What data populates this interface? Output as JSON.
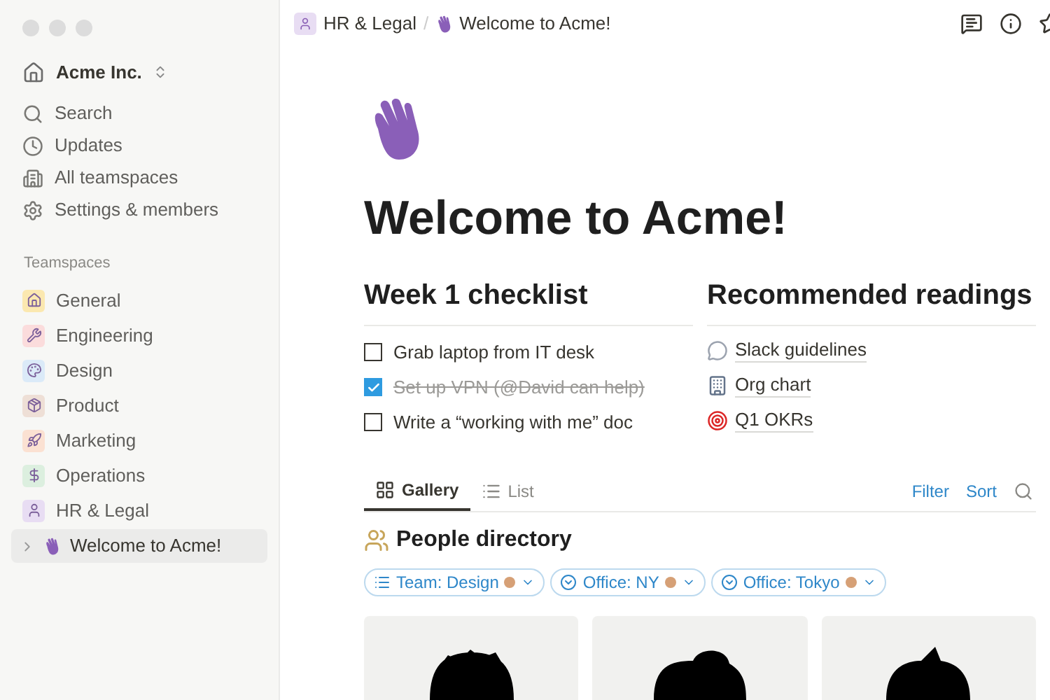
{
  "workspace": {
    "name": "Acme Inc."
  },
  "nav": [
    {
      "label": "Search",
      "kind": "search"
    },
    {
      "label": "Updates",
      "kind": "clock"
    },
    {
      "label": "All teamspaces",
      "kind": "building"
    },
    {
      "label": "Settings & members",
      "kind": "gear"
    }
  ],
  "teamspaces_heading": "Teamspaces",
  "teamspaces": [
    {
      "label": "General",
      "kind": "home",
      "color": "#fbe8b0"
    },
    {
      "label": "Engineering",
      "kind": "wrench",
      "color": "#fbdcdc"
    },
    {
      "label": "Design",
      "kind": "palette",
      "color": "#dbeaf8"
    },
    {
      "label": "Product",
      "kind": "box",
      "color": "#eedfd6"
    },
    {
      "label": "Marketing",
      "kind": "rocket",
      "color": "#fbe1d2"
    },
    {
      "label": "Operations",
      "kind": "dollar",
      "color": "#dcefdf"
    },
    {
      "label": "HR & Legal",
      "kind": "person",
      "color": "#e8ddf3"
    }
  ],
  "current_page": {
    "label": "Welcome to Acme!",
    "selected": true
  },
  "breadcrumb": [
    "HR & Legal",
    "Welcome to Acme!"
  ],
  "breadcrumb_separator": "/",
  "title": "Welcome to Acme!",
  "checklist": {
    "heading": "Week 1 checklist",
    "items": [
      {
        "label": "Grab laptop from IT desk",
        "checked": false
      },
      {
        "label": "Set up VPN (@David can help)",
        "checked": true
      },
      {
        "label": "Write a “working with me” doc",
        "checked": false
      }
    ]
  },
  "readings": {
    "heading": "Recommended readings",
    "items": [
      {
        "label": "Slack guidelines",
        "kind": "speech"
      },
      {
        "label": "Org chart",
        "kind": "building"
      },
      {
        "label": "Q1 OKRs",
        "kind": "target"
      }
    ]
  },
  "views": [
    {
      "label": "Gallery",
      "kind": "gallery",
      "selected": true
    },
    {
      "label": "List",
      "kind": "list",
      "selected": false
    }
  ],
  "view_actions": [
    "Filter",
    "Sort"
  ],
  "database_title": "People directory",
  "filters": [
    {
      "label": "Team: Design",
      "kind": "list"
    },
    {
      "label": "Office: NY",
      "kind": "circle"
    },
    {
      "label": "Office: Tokyo",
      "kind": "circle"
    }
  ],
  "cards": [
    {
      "kind": "curly"
    },
    {
      "kind": "bun"
    },
    {
      "kind": "spiky"
    }
  ]
}
